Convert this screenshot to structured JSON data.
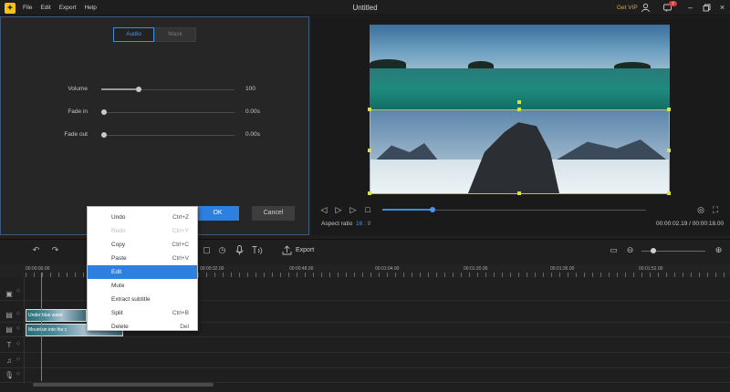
{
  "app": {
    "title": "Untitled",
    "menu": [
      "File",
      "Edit",
      "Export",
      "Help"
    ],
    "get_vip": "Get VIP",
    "notification_count": "2"
  },
  "editor": {
    "tabs": [
      {
        "label": "Audio",
        "active": true
      },
      {
        "label": "Mask",
        "active": false
      }
    ],
    "rows": [
      {
        "label": "Volume",
        "value": "100",
        "level": 0.26
      },
      {
        "label": "Fade in",
        "value": "0.00s",
        "level": 0.0
      },
      {
        "label": "Fade out",
        "value": "0.00s",
        "level": 0.0
      }
    ],
    "ok_label": "OK",
    "cancel_label": "Cancel"
  },
  "preview": {
    "aspect_label": "Aspect ratio",
    "aspect_value": "16 : 9",
    "timecode": "00:00:02.19 / 00:00:18.00",
    "progress": 0.19
  },
  "toolbar": {
    "export_label": "Export",
    "zoom_level": 0.19
  },
  "timeline": {
    "ruler_labels": [
      "00:00:00.00",
      "00:00:32.00",
      "00:00:48.00",
      "00:01:04.00",
      "00:01:20.00",
      "00:01:36.00",
      "00:01:52.00"
    ],
    "clips": [
      {
        "label": "Under blue water"
      },
      {
        "label": "Mountain into the c"
      }
    ]
  },
  "context_menu": {
    "items": [
      {
        "label": "Undo",
        "shortcut": "Ctrl+Z",
        "disabled": false,
        "highlighted": false
      },
      {
        "label": "Redo",
        "shortcut": "Ctrl+Y",
        "disabled": true,
        "highlighted": false
      },
      {
        "label": "Copy",
        "shortcut": "Ctrl+C",
        "disabled": false,
        "highlighted": false
      },
      {
        "label": "Paste",
        "shortcut": "Ctrl+V",
        "disabled": false,
        "highlighted": false
      },
      {
        "label": "Edit",
        "shortcut": "",
        "disabled": false,
        "highlighted": true
      },
      {
        "label": "Mute",
        "shortcut": "",
        "disabled": false,
        "highlighted": false
      },
      {
        "label": "Extract subtitle",
        "shortcut": "",
        "disabled": false,
        "highlighted": false
      },
      {
        "label": "Split",
        "shortcut": "Ctrl+B",
        "disabled": false,
        "highlighted": false
      },
      {
        "label": "Delete",
        "shortcut": "Del",
        "disabled": false,
        "highlighted": false
      }
    ]
  },
  "colors": {
    "accent": "#2d7fe0",
    "vip": "#f0a030",
    "selection": "#b6c43a"
  }
}
